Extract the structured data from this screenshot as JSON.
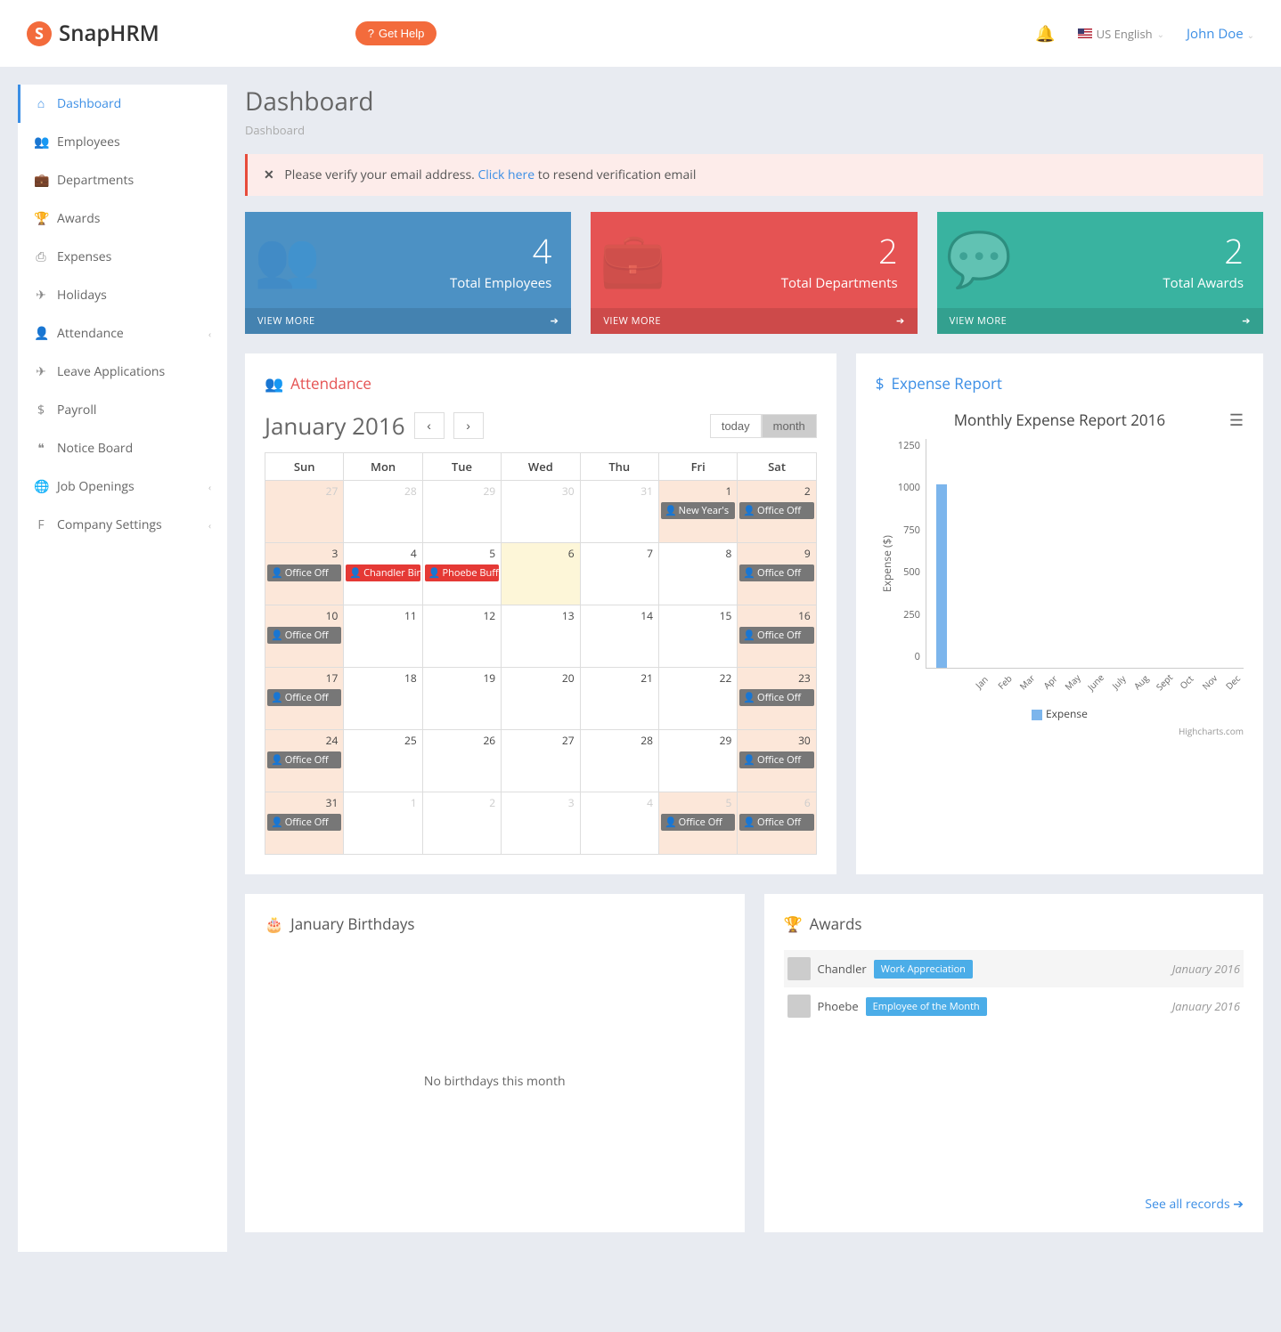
{
  "brand": "SnapHRM",
  "get_help": "Get Help",
  "language": "US English",
  "user": "John Doe",
  "page": {
    "title": "Dashboard",
    "breadcrumb": "Dashboard"
  },
  "alert": {
    "pre": "Please verify your email address. ",
    "link": "Click here",
    "post": " to resend verification email"
  },
  "sidebar": {
    "items": [
      {
        "label": "Dashboard",
        "icon": "⌂"
      },
      {
        "label": "Employees",
        "icon": "👥"
      },
      {
        "label": "Departments",
        "icon": "💼"
      },
      {
        "label": "Awards",
        "icon": "🏆"
      },
      {
        "label": "Expenses",
        "icon": "⎙"
      },
      {
        "label": "Holidays",
        "icon": "✈"
      },
      {
        "label": "Attendance",
        "icon": "👤",
        "chev": true
      },
      {
        "label": "Leave Applications",
        "icon": "✈"
      },
      {
        "label": "Payroll",
        "icon": "$"
      },
      {
        "label": "Notice Board",
        "icon": "❝"
      },
      {
        "label": "Job Openings",
        "icon": "🌐",
        "chev": true
      },
      {
        "label": "Company Settings",
        "icon": "F",
        "chev": true
      }
    ]
  },
  "stats": [
    {
      "num": "4",
      "label": "Total Employees",
      "more": "VIEW MORE"
    },
    {
      "num": "2",
      "label": "Total Departments",
      "more": "VIEW MORE"
    },
    {
      "num": "2",
      "label": "Total Awards",
      "more": "VIEW MORE"
    }
  ],
  "attendance": {
    "title": "Attendance",
    "month": "January 2016",
    "today": "today",
    "monthBtn": "month"
  },
  "calendar": {
    "headers": [
      "Sun",
      "Mon",
      "Tue",
      "Wed",
      "Thu",
      "Fri",
      "Sat"
    ],
    "weeks": [
      [
        {
          "d": "27",
          "other": true,
          "w": true
        },
        {
          "d": "28",
          "other": true
        },
        {
          "d": "29",
          "other": true
        },
        {
          "d": "30",
          "other": true
        },
        {
          "d": "31",
          "other": true
        },
        {
          "d": "1",
          "w": true,
          "ev": [
            {
              "t": "New Year's",
              "c": "off"
            }
          ]
        },
        {
          "d": "2",
          "w": true,
          "ev": [
            {
              "t": "Office Off",
              "c": "off"
            }
          ]
        }
      ],
      [
        {
          "d": "3",
          "w": true,
          "ev": [
            {
              "t": "Office Off",
              "c": "off"
            }
          ]
        },
        {
          "d": "4",
          "ev": [
            {
              "t": "Chandler Bing",
              "c": "red"
            }
          ]
        },
        {
          "d": "5",
          "ev": [
            {
              "t": "Phoebe Buffa",
              "c": "red"
            }
          ]
        },
        {
          "d": "6",
          "hl": true
        },
        {
          "d": "7"
        },
        {
          "d": "8"
        },
        {
          "d": "9",
          "w": true,
          "ev": [
            {
              "t": "Office Off",
              "c": "off"
            }
          ]
        }
      ],
      [
        {
          "d": "10",
          "w": true,
          "ev": [
            {
              "t": "Office Off",
              "c": "off"
            }
          ]
        },
        {
          "d": "11"
        },
        {
          "d": "12"
        },
        {
          "d": "13"
        },
        {
          "d": "14"
        },
        {
          "d": "15"
        },
        {
          "d": "16",
          "w": true,
          "ev": [
            {
              "t": "Office Off",
              "c": "off"
            }
          ]
        }
      ],
      [
        {
          "d": "17",
          "w": true,
          "ev": [
            {
              "t": "Office Off",
              "c": "off"
            }
          ]
        },
        {
          "d": "18"
        },
        {
          "d": "19"
        },
        {
          "d": "20"
        },
        {
          "d": "21"
        },
        {
          "d": "22"
        },
        {
          "d": "23",
          "w": true,
          "ev": [
            {
              "t": "Office Off",
              "c": "off"
            }
          ]
        }
      ],
      [
        {
          "d": "24",
          "w": true,
          "ev": [
            {
              "t": "Office Off",
              "c": "off"
            }
          ]
        },
        {
          "d": "25"
        },
        {
          "d": "26"
        },
        {
          "d": "27"
        },
        {
          "d": "28"
        },
        {
          "d": "29"
        },
        {
          "d": "30",
          "w": true,
          "ev": [
            {
              "t": "Office Off",
              "c": "off"
            }
          ]
        }
      ],
      [
        {
          "d": "31",
          "w": true,
          "ev": [
            {
              "t": "Office Off",
              "c": "off"
            }
          ]
        },
        {
          "d": "1",
          "other": true
        },
        {
          "d": "2",
          "other": true
        },
        {
          "d": "3",
          "other": true
        },
        {
          "d": "4",
          "other": true
        },
        {
          "d": "5",
          "other": true,
          "w": true,
          "ev": [
            {
              "t": "Office Off",
              "c": "off"
            }
          ]
        },
        {
          "d": "6",
          "other": true,
          "w": true,
          "ev": [
            {
              "t": "Office Off",
              "c": "off"
            }
          ]
        }
      ]
    ]
  },
  "expense": {
    "title": "Expense Report",
    "credit": "Highcharts.com"
  },
  "chart_data": {
    "type": "bar",
    "title": "Monthly Expense Report 2016",
    "ylabel": "Expense ($)",
    "categories": [
      "Jan",
      "Feb",
      "Mar",
      "Apr",
      "May",
      "June",
      "July",
      "Aug",
      "Sept",
      "Oct",
      "Nov",
      "Dec"
    ],
    "series": [
      {
        "name": "Expense",
        "values": [
          1000,
          0,
          0,
          0,
          0,
          0,
          0,
          0,
          0,
          0,
          0,
          0
        ]
      }
    ],
    "yticks": [
      1250,
      1000,
      750,
      500,
      250,
      0
    ],
    "ylim": [
      0,
      1250
    ]
  },
  "birthdays": {
    "title": "January Birthdays",
    "empty": "No birthdays this month"
  },
  "awards": {
    "title": "Awards",
    "see_all": "See all records",
    "items": [
      {
        "name": "Chandler",
        "badge": "Work Appreciation",
        "date": "January 2016"
      },
      {
        "name": "Phoebe",
        "badge": "Employee of the Month",
        "date": "January 2016"
      }
    ]
  }
}
